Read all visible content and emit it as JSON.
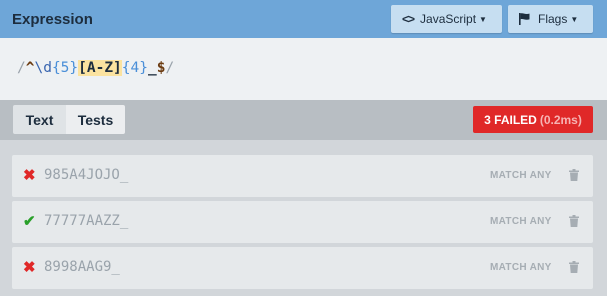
{
  "header": {
    "title": "Expression",
    "language_button": "JavaScript",
    "flags_button": "Flags",
    "language_icon": "code-icon",
    "flags_icon": "flag-icon"
  },
  "expression": {
    "open_delim": "/",
    "anchor_start": "^",
    "escape": "\\d",
    "quant1": "{5}",
    "char_set": "[A-Z]",
    "quant2": "{4}",
    "literal": "_",
    "anchor_end": "$",
    "close_delim": "/"
  },
  "tabs": {
    "text": "Text",
    "tests": "Tests"
  },
  "status": {
    "label": "3 FAILED",
    "time": "(0.2ms)",
    "color": "#e02828"
  },
  "tests": [
    {
      "value": "985A4JOJO_",
      "mode": "MATCH ANY",
      "result": "fail"
    },
    {
      "value": "77777AAZZ_",
      "mode": "MATCH ANY",
      "result": "pass"
    },
    {
      "value": "8998AAG9_",
      "mode": "MATCH ANY",
      "result": "fail"
    }
  ],
  "colors": {
    "header": "#6ea6d8",
    "fail": "#e02828",
    "pass": "#2aa02a"
  }
}
